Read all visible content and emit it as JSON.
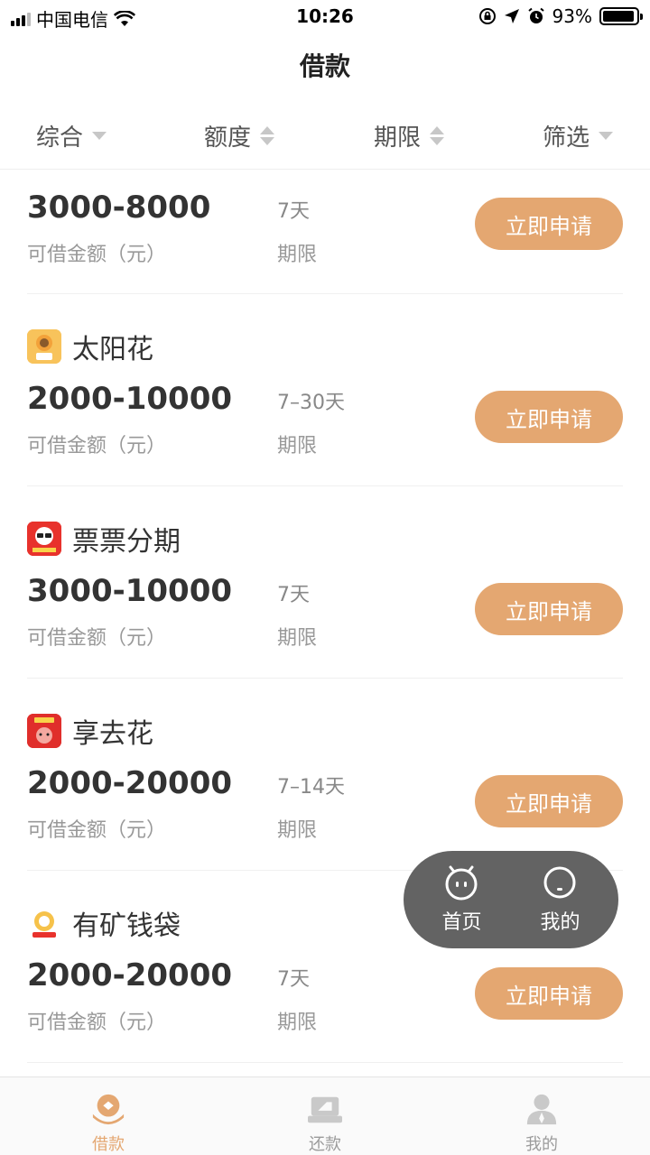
{
  "status_bar": {
    "carrier": "中国电信",
    "time": "10:26",
    "battery": "93%",
    "battery_level": 0.93
  },
  "header": {
    "title": "借款"
  },
  "filters": [
    {
      "label": "综合",
      "indicator": "chevron-down"
    },
    {
      "label": "额度",
      "indicator": "sort-up-down"
    },
    {
      "label": "期限",
      "indicator": "sort-up-down"
    },
    {
      "label": "筛选",
      "indicator": "chevron-down"
    }
  ],
  "loans": [
    {
      "name": "",
      "amount": "3000-8000",
      "amount_label": "可借金额（元）",
      "term": "7天",
      "term_label": "期限",
      "button": "立即申请"
    },
    {
      "name": "太阳花",
      "logo_text": "太阳花",
      "logo_color": "#f6a23a",
      "amount": "2000-10000",
      "amount_label": "可借金额（元）",
      "term": "7–30天",
      "term_label": "期限",
      "button": "立即申请"
    },
    {
      "name": "票票分期",
      "logo_text": "票票",
      "logo_color": "#e8322c",
      "amount": "3000-10000",
      "amount_label": "可借金额（元）",
      "term": "7天",
      "term_label": "期限",
      "button": "立即申请"
    },
    {
      "name": "享去花",
      "logo_text": "享去花",
      "logo_color": "#e02e2b",
      "amount": "2000-20000",
      "amount_label": "可借金额（元）",
      "term": "7–14天",
      "term_label": "期限",
      "button": "立即申请"
    },
    {
      "name": "有矿钱袋",
      "logo_text": "有矿",
      "logo_color": "#f3f3f3",
      "amount": "2000-20000",
      "amount_label": "可借金额（元）",
      "term": "7天",
      "term_label": "期限",
      "button": "立即申请"
    }
  ],
  "float_nav": [
    {
      "label": "首页",
      "icon": "home-face-icon"
    },
    {
      "label": "我的",
      "icon": "profile-face-icon"
    }
  ],
  "tab_bar": [
    {
      "label": "借款",
      "icon": "loan-icon",
      "active": true
    },
    {
      "label": "还款",
      "icon": "repay-icon",
      "active": false
    },
    {
      "label": "我的",
      "icon": "user-icon",
      "active": false
    }
  ],
  "colors": {
    "accent": "#e4a771",
    "float_nav_bg": "#636363",
    "tab_inactive": "#9b9b9b"
  }
}
